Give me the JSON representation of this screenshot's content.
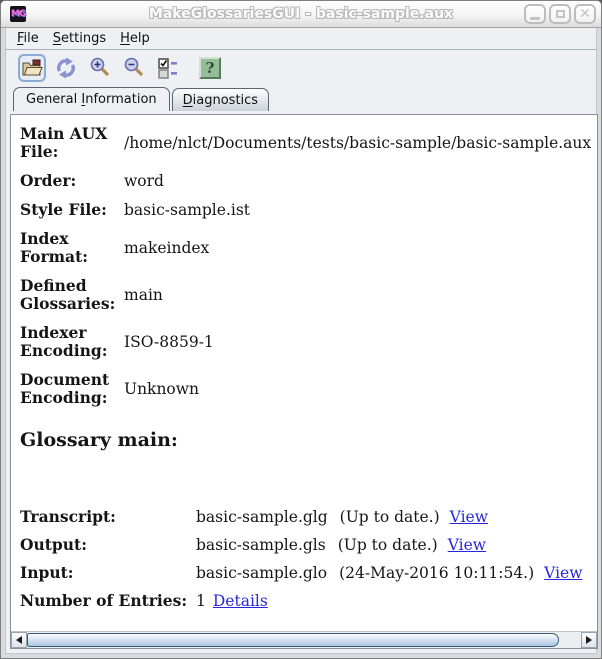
{
  "window": {
    "title": "MakeGlossariesGUI - basic-sample.aux",
    "icon_letters": "MG"
  },
  "menubar": {
    "items": [
      {
        "pre": "",
        "m": "F",
        "post": "ile"
      },
      {
        "pre": "",
        "m": "S",
        "post": "ettings"
      },
      {
        "pre": "",
        "m": "H",
        "post": "elp"
      }
    ]
  },
  "toolbar": {
    "icons": [
      "open-file",
      "reload",
      "zoom-in",
      "zoom-out",
      "diagnostic-options",
      "help"
    ],
    "help_glyph": "?"
  },
  "tabs": [
    {
      "pre": "General ",
      "m": "I",
      "post": "nformation"
    },
    {
      "pre": "",
      "m": "D",
      "post": "iagnostics"
    }
  ],
  "general": {
    "rows": [
      {
        "label": "Main AUX File:",
        "value": "/home/nlct/Documents/tests/basic-sample/basic-sample.aux"
      },
      {
        "label": "Order:",
        "value": "word"
      },
      {
        "label": "Style File:",
        "value": "basic-sample.ist"
      },
      {
        "label": "Index Format:",
        "value": "makeindex"
      },
      {
        "label": "Defined Glossaries:",
        "value": "main"
      },
      {
        "label": "Indexer Encoding:",
        "value": "ISO-8859-1"
      },
      {
        "label": "Document Encoding:",
        "value": "Unknown"
      }
    ],
    "glossary": {
      "heading": "Glossary main:",
      "rows": [
        {
          "label": "Transcript:",
          "value": "basic-sample.glg",
          "status": "(Up to date.)",
          "link": "View"
        },
        {
          "label": "Output:",
          "value": "basic-sample.gls",
          "status": "(Up to date.)",
          "link": "View"
        },
        {
          "label": "Input:",
          "value": "basic-sample.glo",
          "status": "(24-May-2016 10:11:54.)",
          "link": "View"
        },
        {
          "label": "Number of Entries:",
          "value": "1",
          "status": "",
          "link": "Details"
        }
      ]
    }
  },
  "colors": {
    "link": "#2727d8",
    "help_icon_green": "#94bd98",
    "selected_button_border": "#8cabd4",
    "scrollbar_thumb": "#a9c5e1"
  }
}
